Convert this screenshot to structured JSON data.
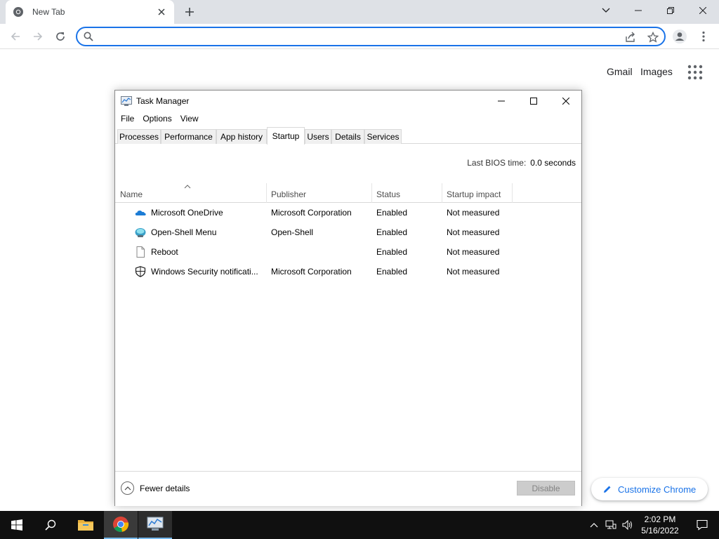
{
  "browser": {
    "tab_title": "New Tab",
    "omnibox_value": "",
    "omnibox_placeholder": ""
  },
  "new_tab_page": {
    "gmail": "Gmail",
    "images": "Images",
    "customize": "Customize Chrome"
  },
  "task_manager": {
    "title": "Task Manager",
    "menu": [
      "File",
      "Options",
      "View"
    ],
    "tabs": [
      "Processes",
      "Performance",
      "App history",
      "Startup",
      "Users",
      "Details",
      "Services"
    ],
    "active_tab": "Startup",
    "bios_label": "Last BIOS time:",
    "bios_value": "0.0 seconds",
    "columns": [
      "Name",
      "Publisher",
      "Status",
      "Startup impact"
    ],
    "rows": [
      {
        "name": "Microsoft OneDrive",
        "publisher": "Microsoft Corporation",
        "status": "Enabled",
        "impact": "Not measured",
        "icon": "onedrive-icon"
      },
      {
        "name": "Open-Shell Menu",
        "publisher": "Open-Shell",
        "status": "Enabled",
        "impact": "Not measured",
        "icon": "open-shell-icon"
      },
      {
        "name": "Reboot",
        "publisher": "",
        "status": "Enabled",
        "impact": "Not measured",
        "icon": "blank-file-icon"
      },
      {
        "name": "Windows Security notificati...",
        "publisher": "Microsoft Corporation",
        "status": "Enabled",
        "impact": "Not measured",
        "icon": "shield-icon"
      }
    ],
    "fewer_details": "Fewer details",
    "disable_button": "Disable"
  },
  "taskbar": {
    "time": "2:02 PM",
    "date": "5/16/2022"
  },
  "colors": {
    "chrome_accent": "#1a73e8",
    "taskbar_bg": "#101010",
    "taskbar_highlight": "#76b9ed"
  }
}
